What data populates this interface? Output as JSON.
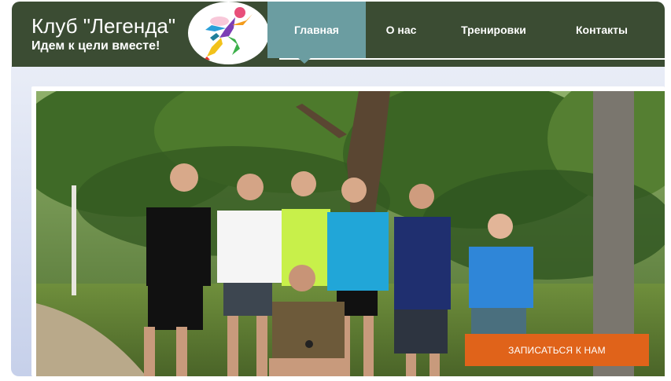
{
  "header": {
    "title": "Клуб \"Легенда\"",
    "tagline": "Идем к цели вместе!"
  },
  "nav": {
    "items": [
      {
        "label": "Главная",
        "active": true
      },
      {
        "label": "О нас",
        "active": false
      },
      {
        "label": "Тренировки",
        "active": false
      },
      {
        "label": "Контакты",
        "active": false
      }
    ]
  },
  "hero": {
    "cta_label": "ЗАПИСАТЬСЯ К НАМ"
  },
  "colors": {
    "header_bg": "#3b4c33",
    "nav_active": "#6b9da1",
    "cta_bg": "#e0631a"
  },
  "icons": [
    "runner-logo-icon"
  ]
}
